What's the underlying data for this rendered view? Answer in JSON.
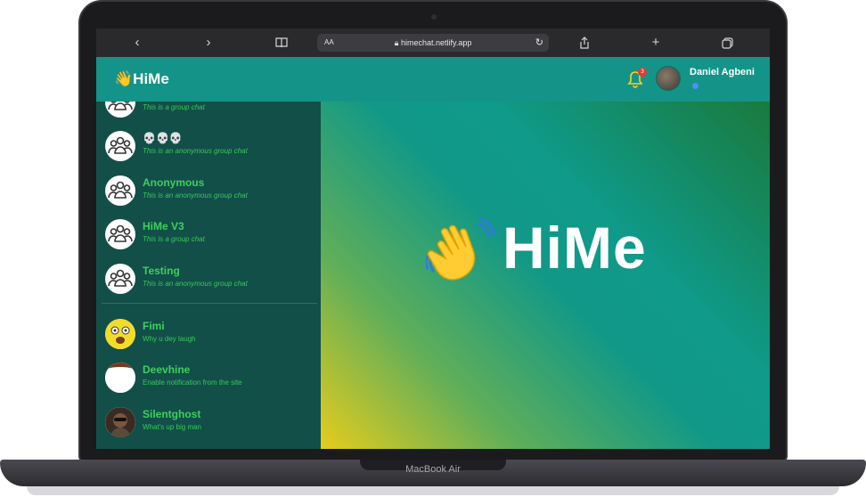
{
  "device": {
    "label": "MacBook Air"
  },
  "browser": {
    "url": "himechat.netlify.app",
    "text_size_label": "AA",
    "back_icon": "chevron-left-icon",
    "forward_icon": "chevron-right-icon"
  },
  "header": {
    "logo_text": "HiMe",
    "notification_count": "3",
    "user_name": "Daniel Agbeni"
  },
  "chats": [
    {
      "name": "",
      "subtitle": "This is a group chat",
      "type": "group"
    },
    {
      "name": "💀💀💀",
      "subtitle": "This is an anonymous group chat",
      "type": "group"
    },
    {
      "name": "Anonymous",
      "subtitle": "This is an anonymous group chat",
      "type": "group"
    },
    {
      "name": "HiMe V3",
      "subtitle": "This is a group chat",
      "type": "group"
    },
    {
      "name": "Testing",
      "subtitle": "This is an anonymous group chat",
      "type": "group"
    },
    {
      "name": "Fimi",
      "subtitle": "Why u dey laugh",
      "type": "user"
    },
    {
      "name": "Deevhine",
      "subtitle": "Enable notification from the site",
      "type": "user"
    },
    {
      "name": "Silentghost",
      "subtitle": "What's up big man",
      "type": "user"
    }
  ],
  "hero": {
    "title": "HiMe"
  },
  "colors": {
    "header": "#149488",
    "sidebar": "#124f48",
    "accent_green": "#3fcf5e",
    "badge": "#e53935"
  }
}
